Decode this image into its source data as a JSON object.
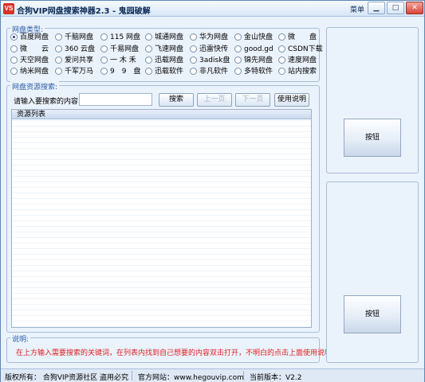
{
  "window": {
    "icon_text": "VS",
    "title": "合狗VIP网盘搜索神器2.3 - 鬼园破解",
    "menu_label": "菜单",
    "min_glyph": "▁",
    "max_glyph": "□",
    "close_glyph": "✕"
  },
  "disk_types": {
    "legend": "网盘类型:",
    "selected_index": 0,
    "options": [
      "百度网盘",
      "千脑网盘",
      "115 网盘",
      "城通网盘",
      "华为网盘",
      "金山快盘",
      "微　　盘",
      "微　　云",
      "360 云盘",
      "千易网盘",
      "飞速网盘",
      "迅雷快传",
      "good.gd",
      "CSDN下载",
      "天空网盘",
      "爱问共享",
      "一 木 禾",
      "迅载网盘",
      "3adisk盘",
      "锦先网盘",
      "速度网盘",
      "纳米网盘",
      "千军万马",
      "9　9　盘",
      "迅载软件",
      "非凡软件",
      "多特软件",
      "站内搜索"
    ]
  },
  "search": {
    "legend": "网盘资源搜索:",
    "label": "请输入要搜索的内容:",
    "input_value": "",
    "search_button": "搜索",
    "prev_button": "上一页",
    "next_button": "下一页",
    "help_button": "使用说明"
  },
  "results": {
    "header": "资源列表"
  },
  "note": {
    "legend": "说明:",
    "text": "在上方输入需要搜索的关键词，在列表内找到自己想要的内容双击打开，不明白的点击上面使用说明"
  },
  "side_panels": {
    "top_button": "按钮",
    "bottom_button": "按钮"
  },
  "status": {
    "copyright": "版权所有：  合狗VIP资源社区    盗用必究",
    "website": "官方网站：www.hegouvip.com",
    "version": "当前版本：V2.2"
  }
}
